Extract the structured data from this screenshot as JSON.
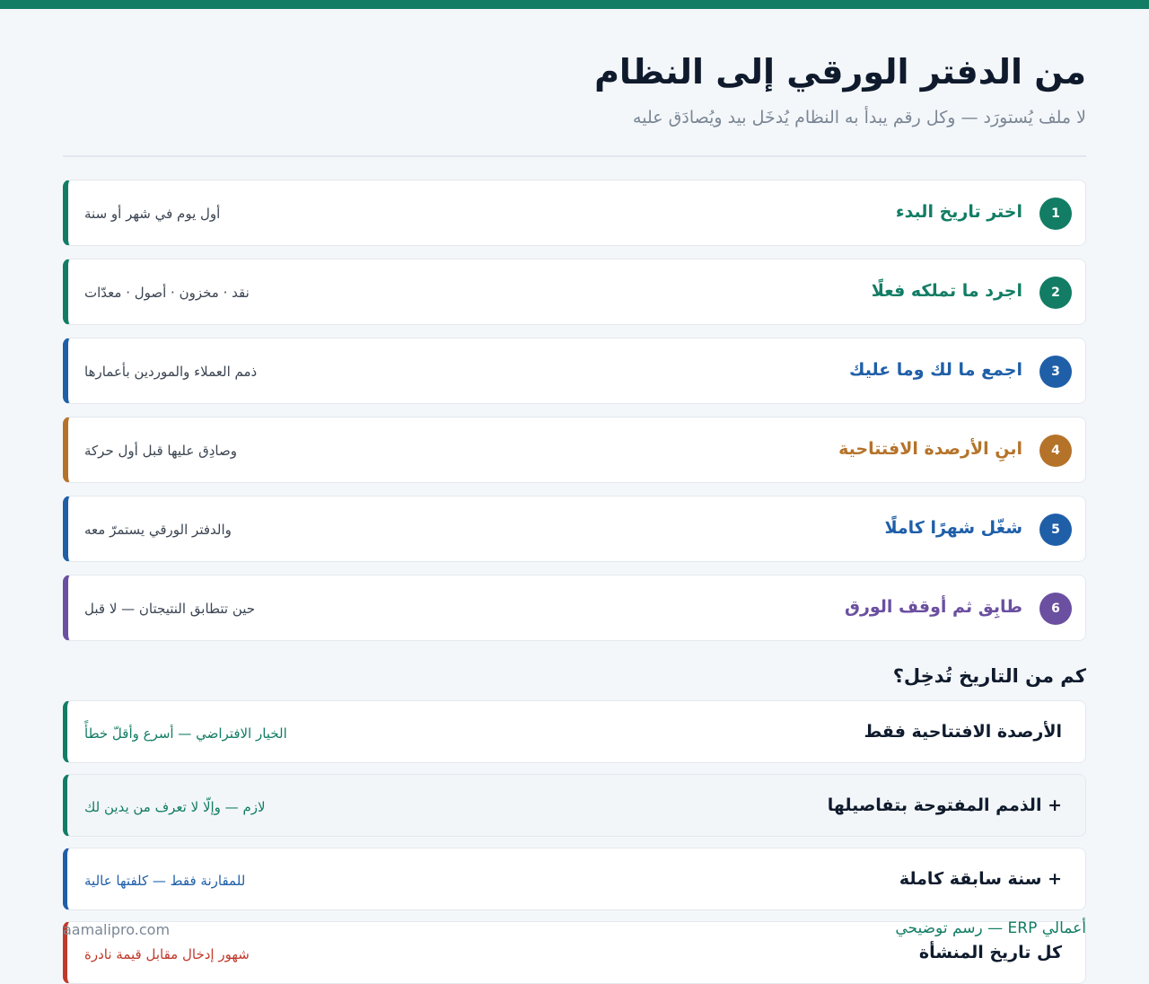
{
  "header": {
    "title": "من الدفتر الورقي إلى النظام",
    "subtitle": "لا ملف يُستورَد — وكل رقم يبدأ به النظام يُدخَل بيد ويُصادَق عليه"
  },
  "steps": [
    {
      "number": "1",
      "title": "اختر تاريخ البدء",
      "note": "أول يوم في شهر أو سنة",
      "color": "#127d64"
    },
    {
      "number": "2",
      "title": "اجرد ما تملكه فعلًا",
      "note": "نقد · مخزون · أصول · معدّات",
      "color": "#127d64"
    },
    {
      "number": "3",
      "title": "اجمع ما لك وما عليك",
      "note": "ذمم العملاء والموردين بأعمارها",
      "color": "#1f5fa8"
    },
    {
      "number": "4",
      "title": "ابنِ الأرصدة الافتتاحية",
      "note": "وصادِق عليها قبل أول حركة",
      "color": "#b5732a"
    },
    {
      "number": "5",
      "title": "شغّل شهرًا كاملًا",
      "note": "والدفتر الورقي يستمرّ معه",
      "color": "#1f5fa8"
    },
    {
      "number": "6",
      "title": "طابِق ثم أوقف الورق",
      "note": "حين تتطابق النتيجتان — لا قبل",
      "color": "#6b4fa0"
    }
  ],
  "history": {
    "title": "كم من التاريخ تُدخِل؟",
    "options": [
      {
        "title": "الأرصدة الافتتاحية فقط",
        "note": "الخيار الافتراضي — أسرع وأقلّ خطأً",
        "color": "#127d64"
      },
      {
        "title": "+ الذمم المفتوحة بتفاصيلها",
        "note": "لازم — وإلّا لا تعرف من يدين لك",
        "color": "#127d64"
      },
      {
        "title": "+ سنة سابقة كاملة",
        "note": "للمقارنة فقط — كلفتها عالية",
        "color": "#1f5fa8"
      },
      {
        "title": "كل تاريخ المنشأة",
        "note": "شهور إدخال مقابل قيمة نادرة",
        "color": "#c0392b"
      }
    ]
  },
  "footer": {
    "site": "aamalipro.com",
    "caption": "أعمالي ERP — رسم توضيحي"
  }
}
